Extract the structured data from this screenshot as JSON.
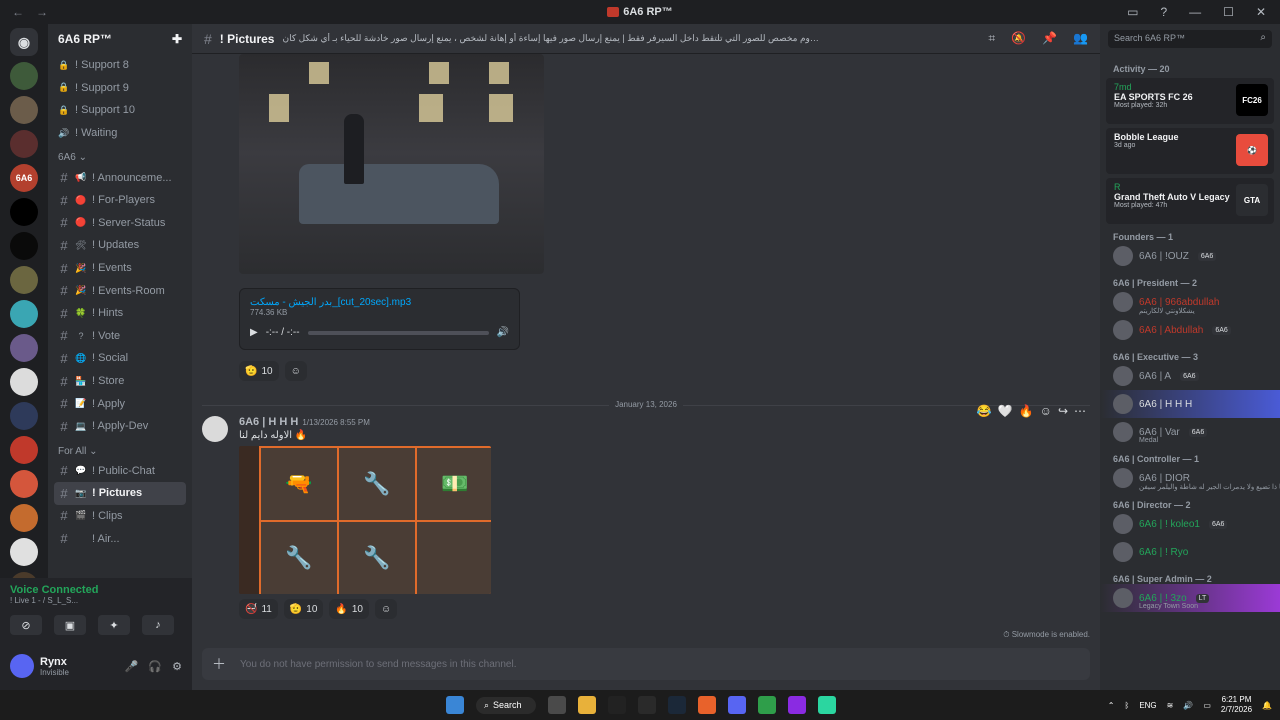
{
  "window": {
    "title": "6A6 RP™",
    "nav_back": "←",
    "nav_forward": "→",
    "controls": [
      "▭",
      "?",
      "—",
      "☐",
      "✕"
    ]
  },
  "guilds": [
    "6A6",
    "",
    "",
    "",
    "",
    "",
    "",
    "",
    "",
    "",
    "",
    "",
    "",
    "",
    "MT"
  ],
  "server": {
    "name": "6A6 RP™",
    "channels_top": [
      {
        "emoji": "🔒",
        "label": "! Support 8"
      },
      {
        "emoji": "🔒",
        "label": "! Support 9"
      },
      {
        "emoji": "🔒",
        "label": "! Support 10"
      },
      {
        "emoji": "🔊",
        "label": "! Waiting"
      }
    ],
    "cat_6a6": "6A6",
    "channels_6a6": [
      {
        "emoji": "📢",
        "label": "! Announceme..."
      },
      {
        "emoji": "🔴",
        "label": "! For-Players"
      },
      {
        "emoji": "🔴",
        "label": "! Server-Status"
      },
      {
        "emoji": "🛠",
        "label": "! Updates"
      },
      {
        "emoji": "🎉",
        "label": "! Events"
      },
      {
        "emoji": "🎉",
        "label": "! Events-Room"
      },
      {
        "emoji": "🍀",
        "label": "! Hints"
      },
      {
        "emoji": "?",
        "label": "! Vote"
      },
      {
        "emoji": "🌐",
        "label": "! Social"
      },
      {
        "emoji": "🏪",
        "label": "! Store"
      },
      {
        "emoji": "📝",
        "label": "! Apply"
      },
      {
        "emoji": "💻",
        "label": "! Apply-Dev"
      }
    ],
    "cat_forall": "For All",
    "channels_forall": [
      {
        "emoji": "💬",
        "label": "! Public-Chat"
      },
      {
        "emoji": "📷",
        "label": "! Pictures"
      },
      {
        "emoji": "🎬",
        "label": "! Clips"
      },
      {
        "emoji": "",
        "label": "! Air..."
      }
    ]
  },
  "voice": {
    "status": "Voice Connected",
    "sub": "! Live 1 - / S_L_S..."
  },
  "user": {
    "name": "Rynx",
    "status": "Invisible"
  },
  "channel_header": {
    "name": "! Pictures",
    "topic": "هذا الروم مخصص للصور التي تلتقط داخل السيرفر فقط | يمنع إرسال صور فيها إساءة أو إهانة لشخص ، يمنع إرسال صور خادشة للحياء بـ أي شكل كان !"
  },
  "messages": {
    "audio_file": "بدر الجيش - مسكت_[cut_20sec].mp3",
    "audio_size": "774.36 KB",
    "audio_time": "-:-- / -:--",
    "reactions1": [
      {
        "emoji": "🫡",
        "count": "10"
      }
    ],
    "date_divider": "January 13, 2026",
    "author": "6A6 | H H H",
    "time": "1/13/2026 8:55 PM",
    "text": "الاوله دايم لنا 🔥",
    "reactions2": [
      {
        "emoji": "🚭",
        "count": "11"
      },
      {
        "emoji": "🫡",
        "count": "10"
      },
      {
        "emoji": "🔥",
        "count": "10"
      }
    ],
    "slowmode": "Slowmode is enabled.",
    "composer_placeholder": "You do not have permission to send messages in this channel."
  },
  "search": {
    "placeholder": "Search 6A6 RP™"
  },
  "members": {
    "activity_header": "Activity — 20",
    "activities": [
      {
        "user": "7md",
        "game": "EA SPORTS FC 26",
        "sub": "Most played: 32h",
        "icon": "FC26"
      },
      {
        "user": "",
        "game": "Bobble League",
        "sub": "3d ago",
        "icon": "⚽"
      },
      {
        "user": "R",
        "game": "Grand Theft Auto V Legacy",
        "sub": "Most played: 47h",
        "icon": "GTA"
      }
    ],
    "groups": [
      {
        "header": "Founders — 1",
        "members": [
          {
            "name": "6A6 | !OUZ",
            "tag": "6A6",
            "sub": ""
          }
        ]
      },
      {
        "header": "6A6 | President — 2",
        "members": [
          {
            "name": "6A6 | 966abdullah",
            "tag": "",
            "sub": "يشكلاونتي لالكاريتم"
          },
          {
            "name": "6A6 | Abdullah",
            "tag": "6A6",
            "sub": ""
          }
        ]
      },
      {
        "header": "6A6 | Executive — 3",
        "members": [
          {
            "name": "6A6 | A",
            "tag": "6A6",
            "sub": ""
          },
          {
            "name": "6A6 | H H H",
            "tag": "",
            "sub": ""
          },
          {
            "name": "6A6 | Var",
            "tag": "6A6",
            "sub": "Medal"
          }
        ]
      },
      {
        "header": "6A6 | Controller — 1",
        "members": [
          {
            "name": "6A6 | DIOR",
            "tag": "",
            "sub": "يا ذا تضيع ولا يدمرات الجير له شاطة واليلمر سيفن"
          }
        ]
      },
      {
        "header": "6A6 | Director — 2",
        "members": [
          {
            "name": "6A6 | ! koleo1",
            "tag": "6A6",
            "sub": ""
          },
          {
            "name": "6A6 | ! Ryo",
            "tag": "",
            "sub": ""
          }
        ]
      },
      {
        "header": "6A6 | Super Admin — 2",
        "members": [
          {
            "name": "6A6 | ! 3zo",
            "tag": "LT",
            "sub": "Legacy Town Soon"
          }
        ]
      }
    ]
  },
  "taskbar": {
    "search": "Search",
    "lang": "ENG",
    "time": "6:21 PM",
    "date": "2/7/2026"
  }
}
